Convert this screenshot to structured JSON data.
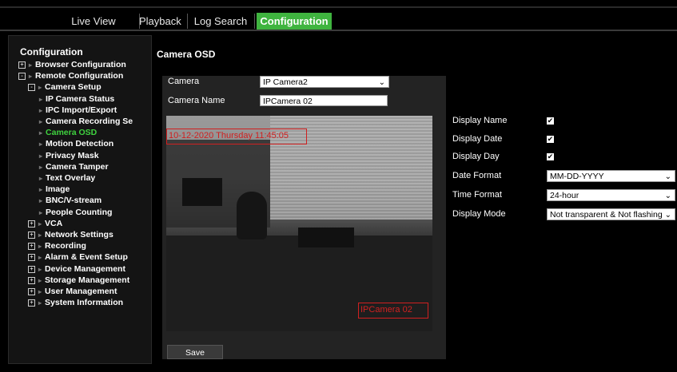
{
  "nav": {
    "tabs": [
      {
        "label": "Live View"
      },
      {
        "label": "Playback"
      },
      {
        "label": "Log Search"
      },
      {
        "label": "Configuration",
        "active": true
      }
    ]
  },
  "sidebar": {
    "title": "Configuration",
    "items": [
      {
        "label": "Browser Configuration",
        "level": 0,
        "expander": "+"
      },
      {
        "label": "Remote Configuration",
        "level": 0,
        "expander": "-"
      },
      {
        "label": "Camera Setup",
        "level": 1,
        "expander": "-"
      },
      {
        "label": "IP Camera Status",
        "level": 2
      },
      {
        "label": "IPC Import/Export",
        "level": 2
      },
      {
        "label": "Camera Recording Se",
        "level": 2
      },
      {
        "label": "Camera OSD",
        "level": 2,
        "selected": true
      },
      {
        "label": "Motion Detection",
        "level": 2
      },
      {
        "label": "Privacy Mask",
        "level": 2
      },
      {
        "label": "Camera Tamper",
        "level": 2
      },
      {
        "label": "Text Overlay",
        "level": 2
      },
      {
        "label": "Image",
        "level": 2
      },
      {
        "label": "BNC/V-stream",
        "level": 2
      },
      {
        "label": "People Counting",
        "level": 2
      },
      {
        "label": "VCA",
        "level": 1,
        "expander": "+"
      },
      {
        "label": "Network Settings",
        "level": 1,
        "expander": "+"
      },
      {
        "label": "Recording",
        "level": 1,
        "expander": "+"
      },
      {
        "label": "Alarm & Event Setup",
        "level": 1,
        "expander": "+"
      },
      {
        "label": "Device Management",
        "level": 1,
        "expander": "+"
      },
      {
        "label": "Storage Management",
        "level": 1,
        "expander": "+"
      },
      {
        "label": "User Management",
        "level": 1,
        "expander": "+"
      },
      {
        "label": "System Information",
        "level": 1,
        "expander": "+"
      }
    ]
  },
  "main": {
    "title": "Camera OSD",
    "camera_label": "Camera",
    "camera_value": "IP Camera2",
    "camera_name_label": "Camera Name",
    "camera_name_value": "IPCamera 02",
    "osd_datetime": "10-12-2020 Thursday 11:45:05",
    "osd_name": "IPCamera 02",
    "save_label": "Save"
  },
  "settings": {
    "display_name_label": "Display Name",
    "display_date_label": "Display Date",
    "display_day_label": "Display Day",
    "date_format_label": "Date Format",
    "date_format_value": "MM-DD-YYYY",
    "time_format_label": "Time Format",
    "time_format_value": "24-hour",
    "display_mode_label": "Display Mode",
    "display_mode_value": "Not transparent & Not flashing",
    "display_name_checked": true,
    "display_date_checked": true,
    "display_day_checked": true
  },
  "colors": {
    "active_tab": "#3fb43f",
    "selected_item": "#3fd23f",
    "osd_red": "#d02020"
  }
}
